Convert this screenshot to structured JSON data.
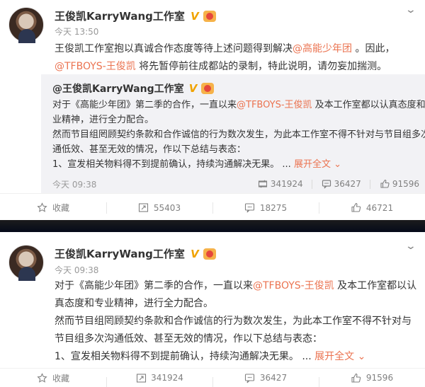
{
  "post1": {
    "author": "王俊凯KarryWang工作室",
    "verified_mark": "V",
    "time": "今天 13:50",
    "text_lines": [
      [
        "王俊凯工作室抱以真诚合作态度等待上述问题得到解决",
        "@高能少年团",
        " 。因此，"
      ],
      [
        "@TFBOYS-王俊凯",
        " 将先暂停前往成都站的录制，特此说明，请勿妄加揣测。"
      ]
    ],
    "quote": {
      "author": "@王俊凯KarryWang工作室",
      "verified_mark": "V",
      "lines": [
        [
          "对于《高能少年团》第二季的合作，一直以来",
          "@TFBOYS-王俊凯",
          " 及本工作室都以认真态度和专"
        ],
        [
          "业精神，进行全力配合。",
          "",
          ""
        ],
        [
          "然而节目组罔顾契约条款和合作诚信的行为数次发生，为此本工作室不得不针对与节目组多次沟",
          "",
          ""
        ],
        [
          "通低效、甚至无效的情况，作以下总结与表态：",
          "",
          ""
        ],
        [
          "1、宣发相关物料得不到提前确认，持续沟通解决无果。 ... ",
          "展开全文",
          " ⌄"
        ]
      ],
      "time": "今天 09:38",
      "reposts": "341924",
      "comments": "36427",
      "likes": "91596"
    },
    "actions": {
      "favorite": "收藏",
      "reposts": "55403",
      "comments": "18275",
      "likes": "46721"
    }
  },
  "post2": {
    "author": "王俊凯KarryWang工作室",
    "verified_mark": "V",
    "time": "今天 09:38",
    "text_lines": [
      [
        "对于《高能少年团》第二季的合作，一直以来",
        "@TFBOYS-王俊凯",
        " 及本工作室都以认"
      ],
      [
        "真态度和专业精神，进行全力配合。",
        "",
        ""
      ],
      [
        "然而节目组罔顾契约条款和合作诚信的行为数次发生，为此本工作室不得不针对与",
        "",
        ""
      ],
      [
        "节目组多次沟通低效、甚至无效的情况，作以下总结与表态：",
        "",
        ""
      ],
      [
        "1、宣发相关物料得不到提前确认，持续沟通解决无果。 ... ",
        "展开全文",
        " ⌄"
      ]
    ],
    "actions": {
      "favorite": "收藏",
      "reposts": "341924",
      "comments": "36427",
      "likes": "91596"
    }
  },
  "colors": {
    "link": "#eb7350",
    "verified": "#f0a300",
    "quote_bg": "#f2f2f5",
    "divider": "#0a0f1e"
  },
  "icons": [
    "chevron-down-icon",
    "verified-icon",
    "medal-icon",
    "star-icon",
    "repost-icon",
    "comment-icon",
    "like-icon"
  ]
}
